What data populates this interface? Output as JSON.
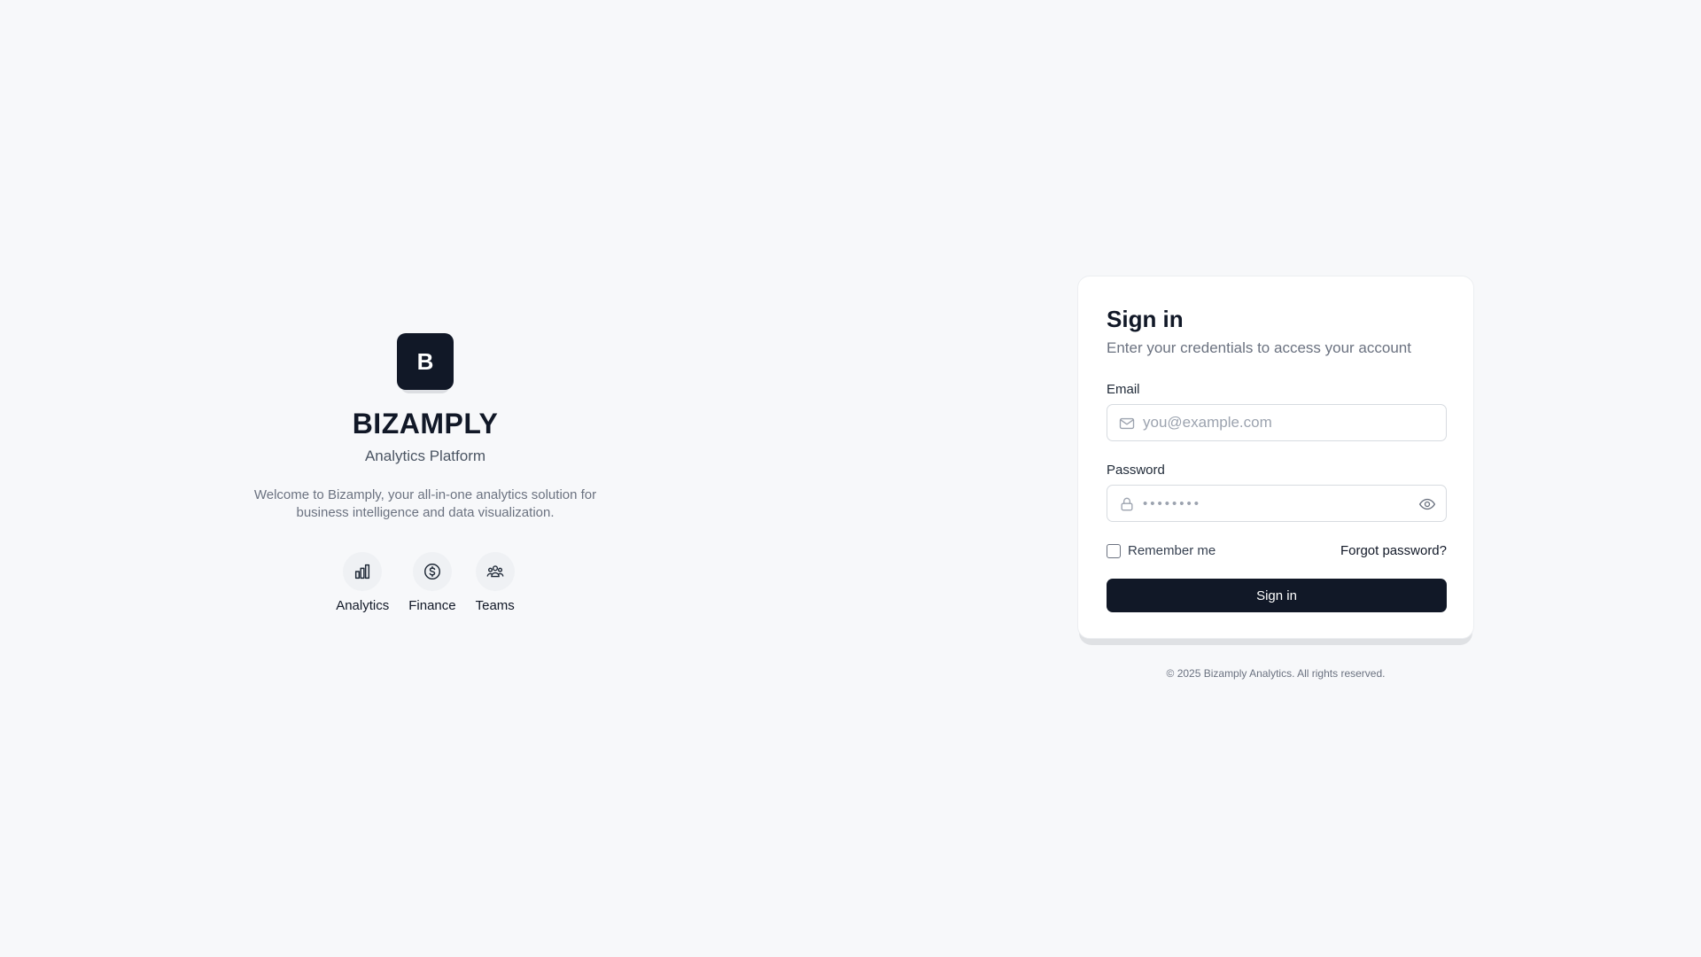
{
  "brand": {
    "logo_letter": "B",
    "name": "BIZAMPLY",
    "tagline": "Analytics Platform",
    "description": "Welcome to Bizamply, your all-in-one analytics solution for business intelligence and data visualization.",
    "features": [
      {
        "label": "Analytics",
        "icon": "bar-chart-icon"
      },
      {
        "label": "Finance",
        "icon": "dollar-circle-icon"
      },
      {
        "label": "Teams",
        "icon": "users-icon"
      }
    ]
  },
  "signin": {
    "title": "Sign in",
    "subtitle": "Enter your credentials to access your account",
    "email": {
      "label": "Email",
      "placeholder": "you@example.com",
      "value": ""
    },
    "password": {
      "label": "Password",
      "placeholder": "••••••••",
      "value": ""
    },
    "remember_label": "Remember me",
    "remember_checked": false,
    "forgot_label": "Forgot password?",
    "submit_label": "Sign in"
  },
  "footer": {
    "text": "© 2025 Bizamply Analytics. All rights reserved."
  },
  "colors": {
    "background": "#f7f8fa",
    "primary": "#111827",
    "muted_text": "#6b7280",
    "border": "#d7dbe0"
  }
}
